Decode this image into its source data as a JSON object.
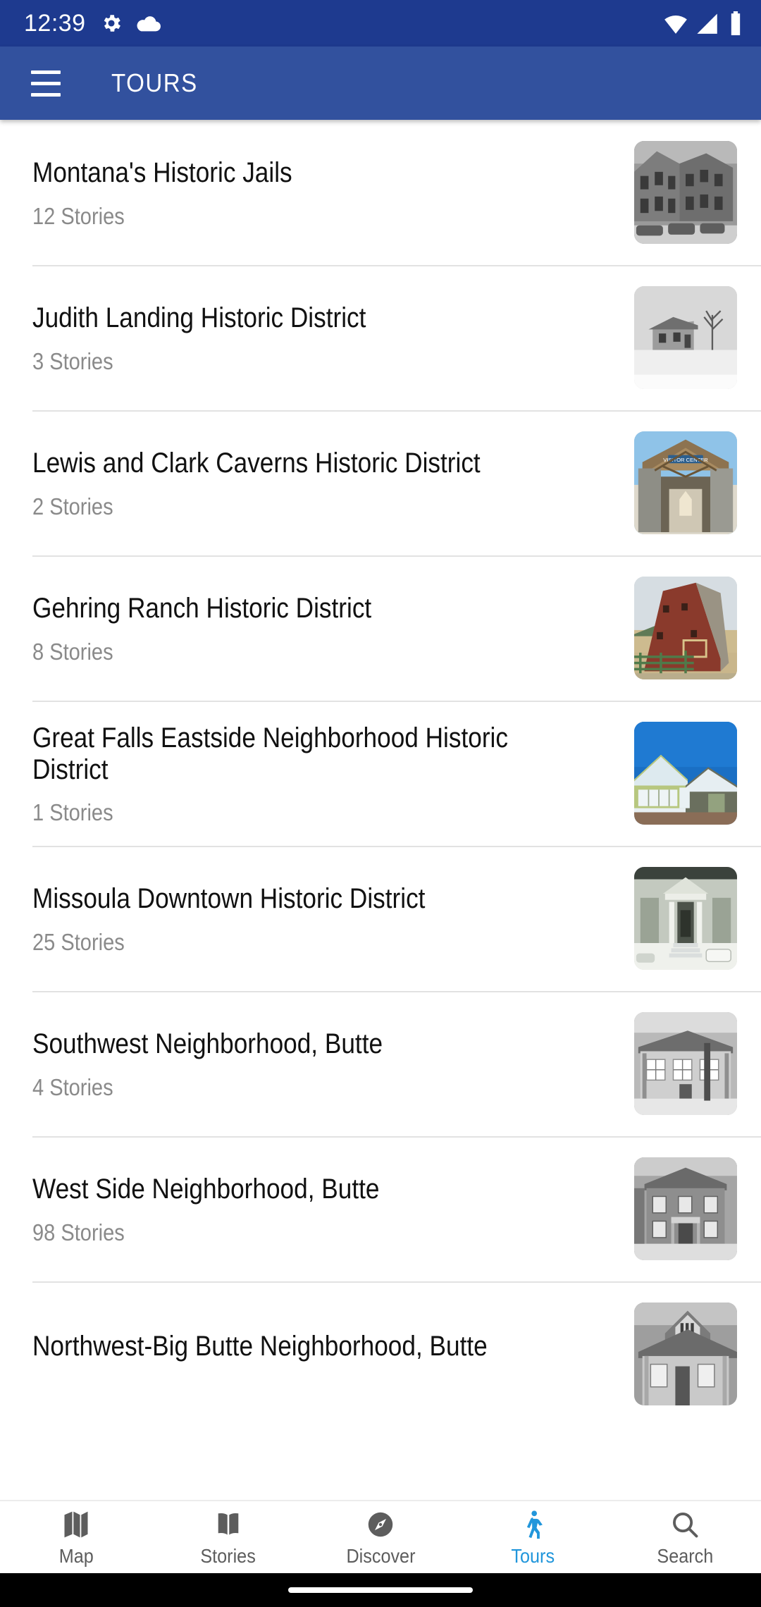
{
  "status_bar": {
    "time": "12:39",
    "left_icons": [
      "gear-icon",
      "cloud-icon"
    ],
    "right_icons": [
      "wifi-icon",
      "cellular-signal-icon",
      "battery-icon"
    ],
    "background_color": "#1e3a8f"
  },
  "app_bar": {
    "menu_icon": "hamburger-menu-icon",
    "title": "TOURS",
    "background_color": "#32519e"
  },
  "tours": [
    {
      "title": "Montana's Historic Jails",
      "stories": "12 Stories",
      "thumb": "bw-stone-building"
    },
    {
      "title": "Judith Landing Historic District",
      "stories": "3 Stories",
      "thumb": "bw-farmhouse-winter"
    },
    {
      "title": "Lewis and Clark Caverns Historic District",
      "stories": "2 Stories",
      "thumb": "visitor-center-pavilion"
    },
    {
      "title": "Gehring Ranch Historic District",
      "stories": "8 Stories",
      "thumb": "red-barn"
    },
    {
      "title": "Great Falls Eastside Neighborhood Historic District",
      "stories": "1 Stories",
      "thumb": "green-bungalow"
    },
    {
      "title": "Missoula Downtown Historic District",
      "stories": "25 Stories",
      "thumb": "bw-columned-building"
    },
    {
      "title": "Southwest Neighborhood, Butte",
      "stories": "4 Stories",
      "thumb": "bw-house-porch"
    },
    {
      "title": "West Side Neighborhood, Butte",
      "stories": "98 Stories",
      "thumb": "bw-two-story-house"
    },
    {
      "title": "Northwest-Big Butte Neighborhood, Butte",
      "stories": "",
      "thumb": "bw-gabled-house"
    }
  ],
  "bottom_nav": {
    "active_color": "#2196db",
    "inactive_color": "#5d5d5d",
    "items": [
      {
        "label": "Map",
        "icon": "map-icon",
        "active": false
      },
      {
        "label": "Stories",
        "icon": "open-book-icon",
        "active": false
      },
      {
        "label": "Discover",
        "icon": "compass-icon",
        "active": false
      },
      {
        "label": "Tours",
        "icon": "walking-person-icon",
        "active": true
      },
      {
        "label": "Search",
        "icon": "search-icon",
        "active": false
      }
    ]
  }
}
